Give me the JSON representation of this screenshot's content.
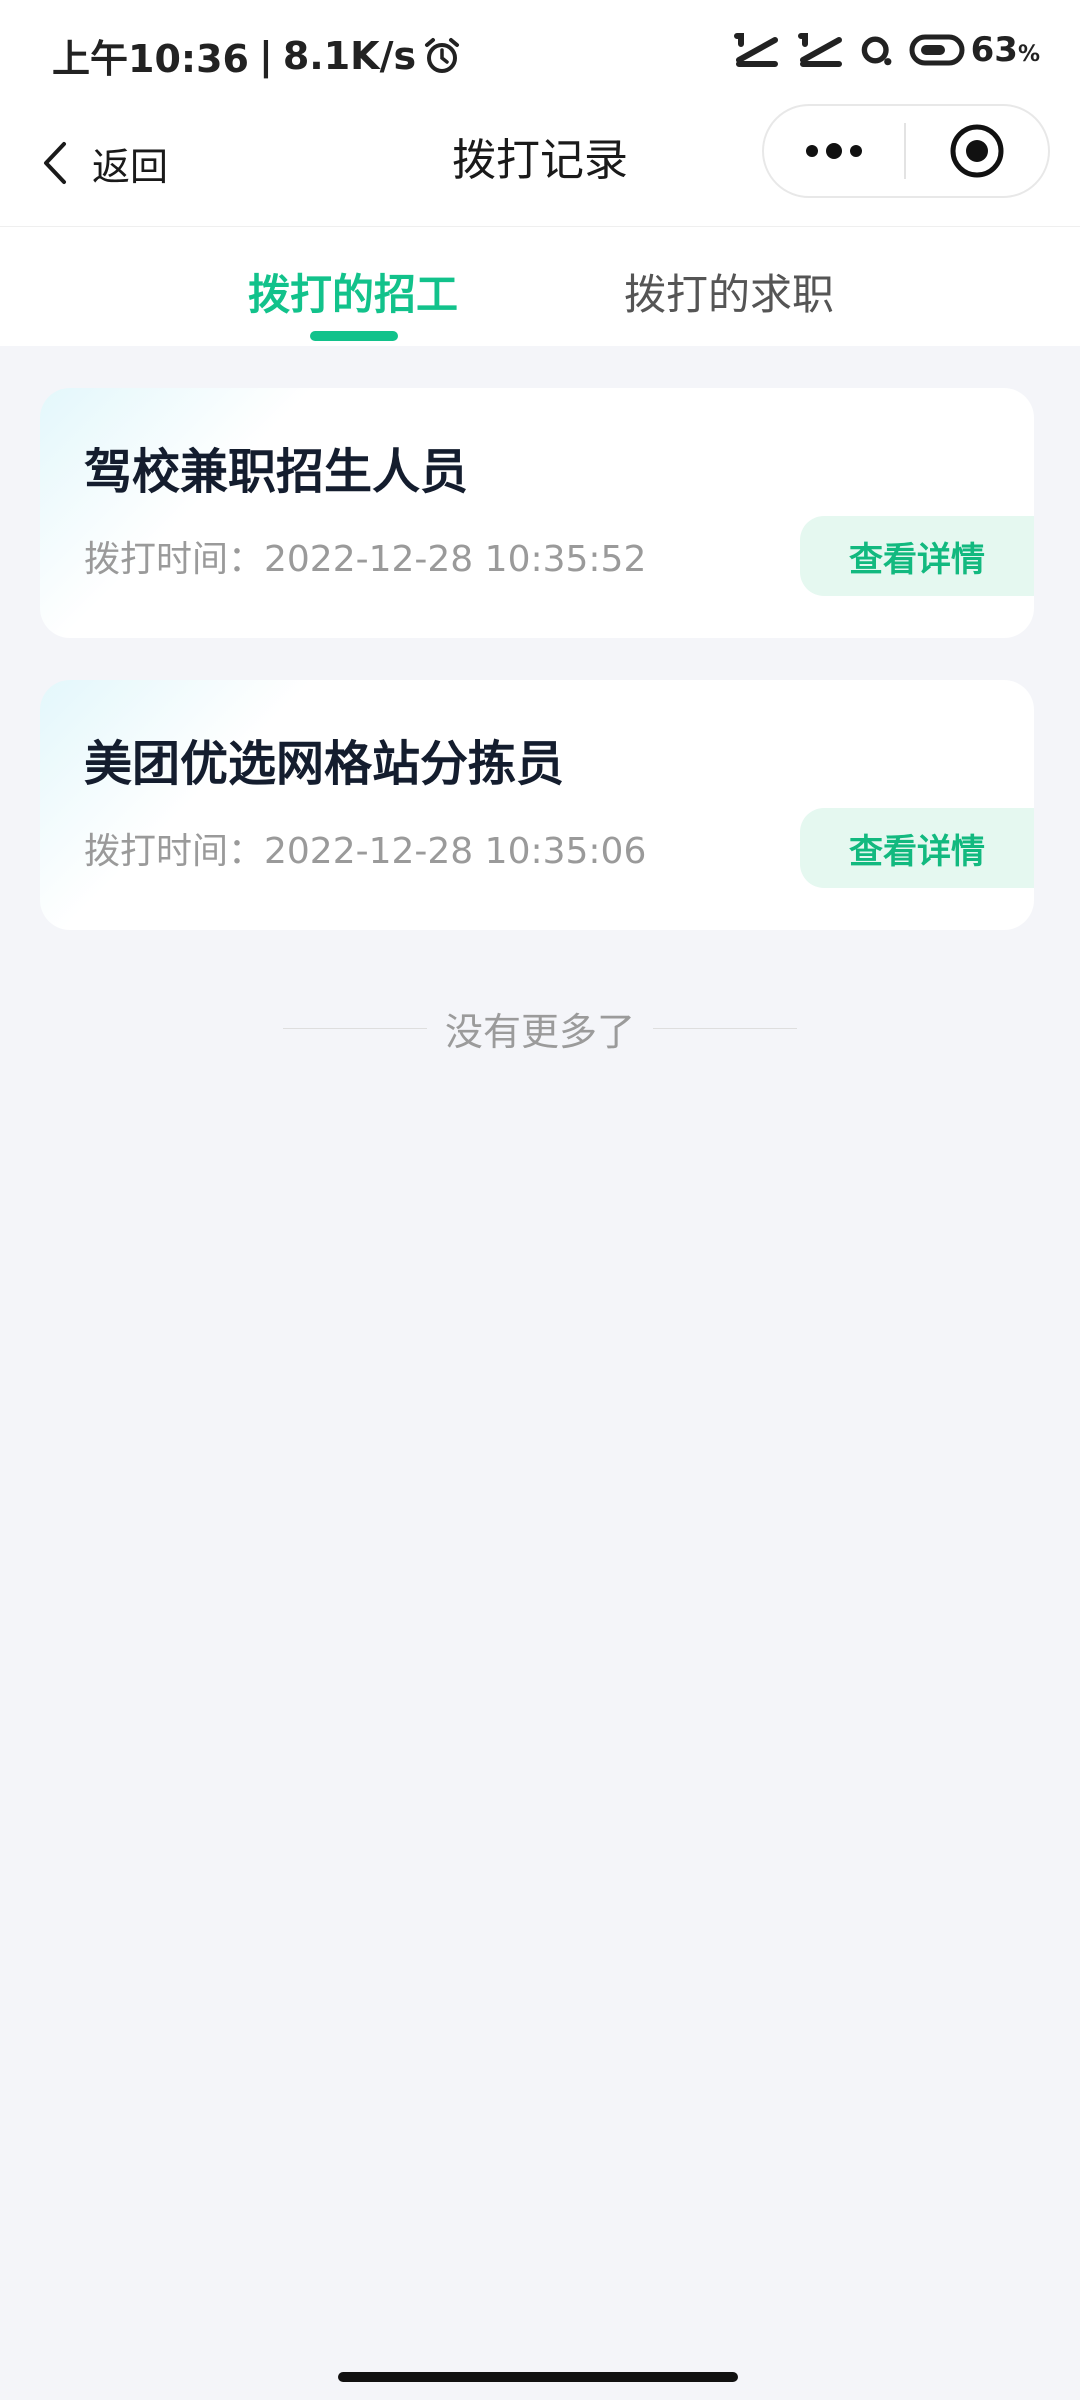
{
  "status_bar": {
    "time": "上午10:36",
    "separator": "|",
    "network_speed": "8.1K/s",
    "battery_percent": "63",
    "battery_unit": "%"
  },
  "nav": {
    "back_label": "返回",
    "title": "拨打记录"
  },
  "tabs": [
    {
      "label": "拨打的招工",
      "active": true
    },
    {
      "label": "拨打的求职",
      "active": false
    }
  ],
  "records": [
    {
      "title": "驾校兼职招生人员",
      "time": "拨打时间：2022-12-28 10:35:52",
      "button": "查看详情"
    },
    {
      "title": "美团优选网格站分拣员",
      "time": "拨打时间：2022-12-28 10:35:06",
      "button": "查看详情"
    }
  ],
  "footer": {
    "no_more": "没有更多了"
  },
  "colors": {
    "accent": "#12c28b",
    "background": "#f4f5f9",
    "button_bg": "#e5f8f0"
  },
  "icons": [
    "alarm-icon",
    "signal-icon",
    "battery-icon",
    "back-chevron-icon",
    "more-icon",
    "close-target-icon"
  ]
}
